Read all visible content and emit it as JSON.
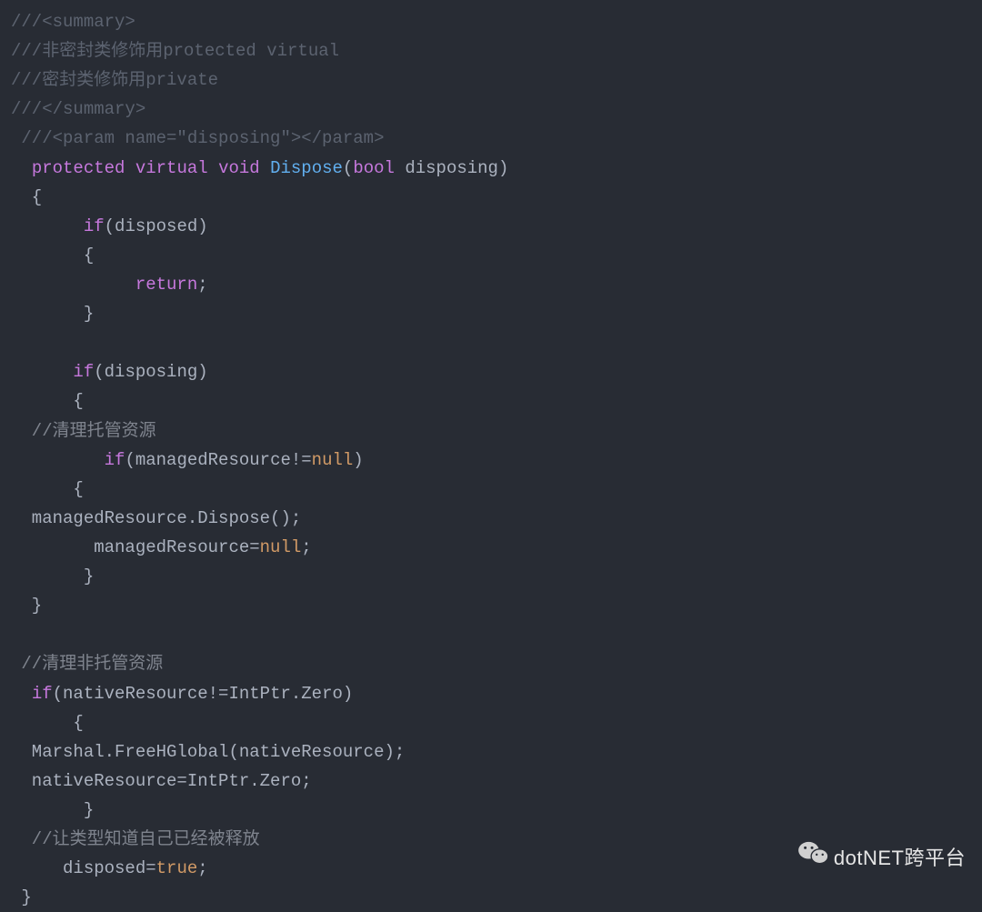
{
  "code": {
    "c1": "///<summary>",
    "c2": "///非密封类修饰用protected virtual",
    "c3": "///密封类修饰用private",
    "c4": "///</summary>",
    "c5": " ///<param name=\"disposing\"></param>",
    "kw_protected": "protected",
    "kw_virtual": "virtual",
    "kw_void": "void",
    "fn_dispose": "Dispose",
    "ty_bool": "bool",
    "param_disposing": " disposing)",
    "brace_open1": "  {",
    "if1_kw": "if",
    "if1_cond": "(disposed)",
    "brace_open2": "       {",
    "kw_return": "return",
    "semi": ";",
    "brace_close2": "       }",
    "if2_kw": "if",
    "if2_cond": "(disposing)",
    "brace_open3": "      {",
    "c6": "  //清理托管资源",
    "if3_kw": "if",
    "if3_cond_a": "(managedResource!=",
    "kw_null": "null",
    "if3_cond_b": ")",
    "brace_open4": "      {",
    "line_mr_dispose": "  managedResource.Dispose();",
    "line_mr_null_a": "        managedResource=",
    "line_mr_null_b": ";",
    "brace_close4": "       }",
    "brace_close3": "  }",
    "c7": " //清理非托管资源",
    "if4_kw": "if",
    "if4_cond": "(nativeResource!=IntPtr.Zero)",
    "brace_open5": "      {",
    "line_free": "  Marshal.FreeHGlobal(nativeResource);",
    "line_native_zero": "  nativeResource=IntPtr.Zero;",
    "brace_close5": "       }",
    "c8": "  //让类型知道自己已经被释放",
    "line_disposed_a": "     disposed=",
    "kw_true": "true",
    "line_disposed_b": ";",
    "brace_close1": " }",
    "sp1": " ",
    "sp2": " ",
    "sp3": " ",
    "sp4": "(",
    "sp7": "       ",
    "sp6": "      ",
    "sp12": "            ",
    "sp9": "         ",
    "sp2b": "  "
  },
  "watermark": {
    "text": "dotNET跨平台"
  }
}
